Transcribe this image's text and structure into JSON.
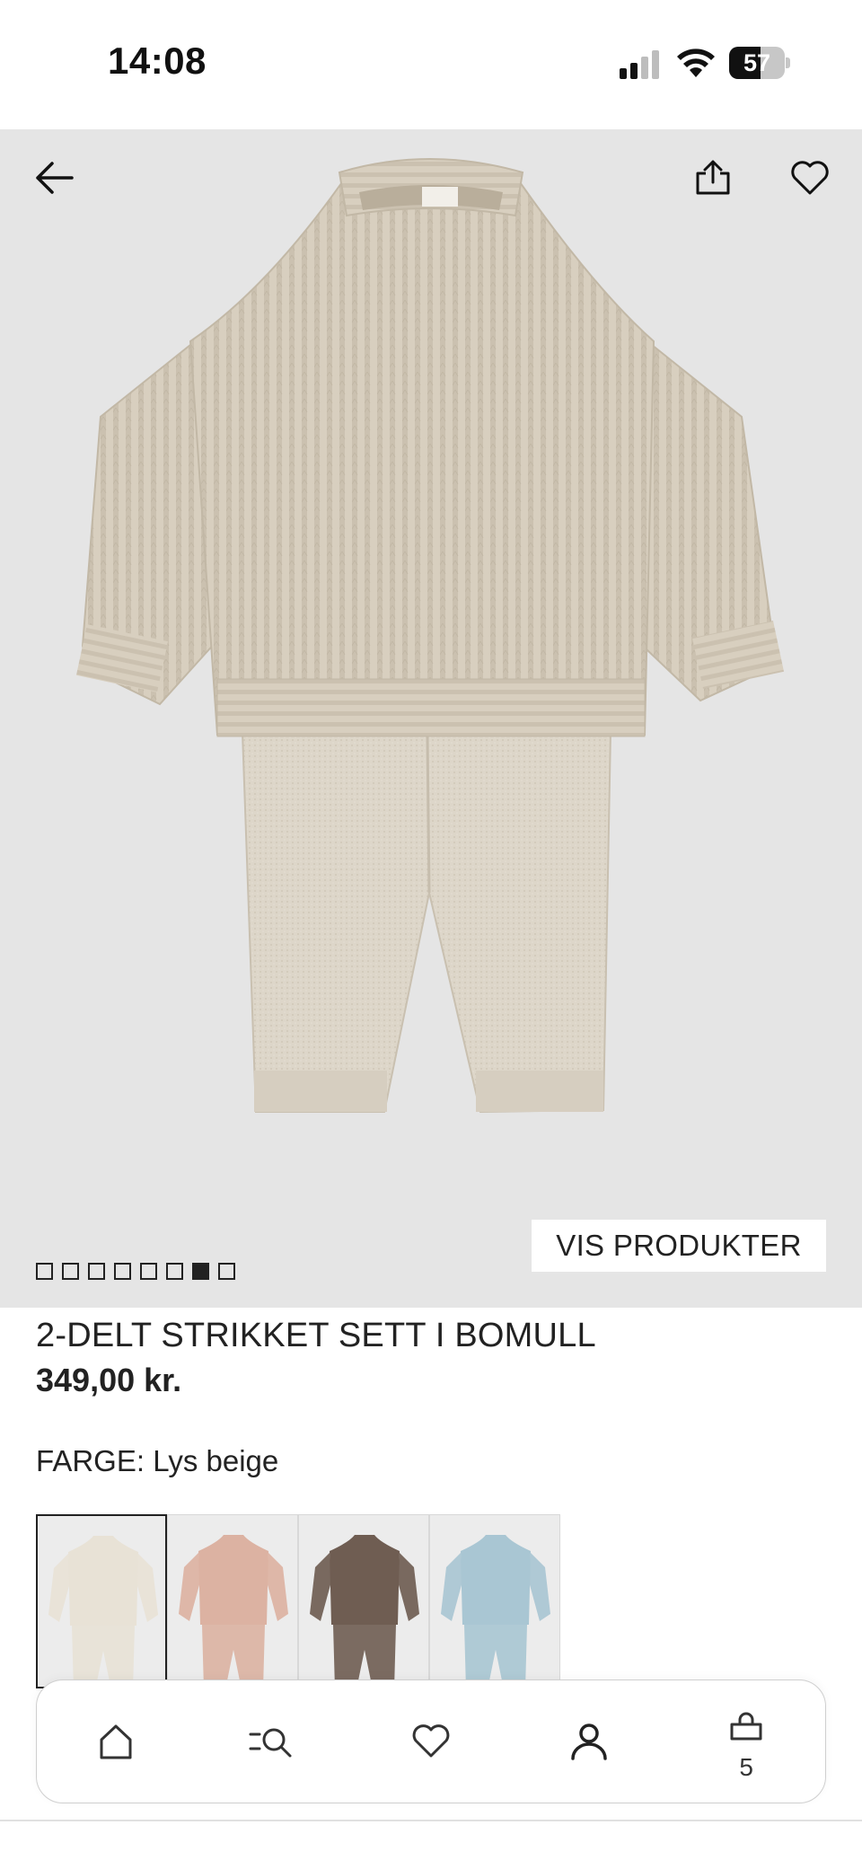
{
  "status_bar": {
    "time": "14:08",
    "battery": "57",
    "battery_level": 0.57
  },
  "hero": {
    "show_products_label": "VIS PRODUKTER",
    "gallery_count": 8,
    "gallery_active_index": 6
  },
  "product": {
    "title": "2-DELT STRIKKET SETT I BOMULL",
    "price": "349,00 kr.",
    "color_label": "FARGE: Lys beige"
  },
  "swatches": [
    {
      "name": "light-beige",
      "color": "#e8e2d6",
      "selected": true
    },
    {
      "name": "pink",
      "color": "#dcb2a2",
      "selected": false
    },
    {
      "name": "brown",
      "color": "#6f5d52",
      "selected": false
    },
    {
      "name": "light-blue",
      "color": "#a9c6d3",
      "selected": false
    }
  ],
  "nav": {
    "items": [
      "home-icon",
      "search-menu-icon",
      "heart-icon",
      "user-icon",
      "shopping-bag-icon"
    ],
    "cart_count": "5"
  },
  "colors": {
    "hero_background": "#e5e5e5",
    "knit": "#d6cdbd",
    "text": "#222222"
  }
}
